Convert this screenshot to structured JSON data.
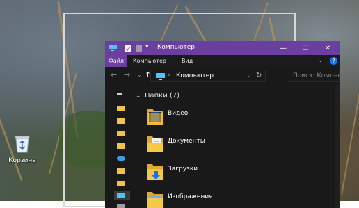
{
  "desktop": {
    "recycle_bin_label": "Корзина"
  },
  "window": {
    "title": "Компьютер",
    "ribbon_tabs": [
      "Файл",
      "Компьютер",
      "Вид"
    ],
    "help_label": "?",
    "address_path": "Компьютер",
    "search_placeholder": "Поиск: Компьютер",
    "group_header": "Папки (7)",
    "folders": [
      {
        "label": "Видео",
        "icon": "video-folder-icon"
      },
      {
        "label": "Документы",
        "icon": "documents-folder-icon"
      },
      {
        "label": "Загрузки",
        "icon": "downloads-folder-icon"
      },
      {
        "label": "Изображения",
        "icon": "pictures-folder-icon"
      }
    ]
  },
  "colors": {
    "titlebar_accent": "#6b3fa0",
    "window_background": "#191919",
    "help_button": "#1a73e8"
  }
}
